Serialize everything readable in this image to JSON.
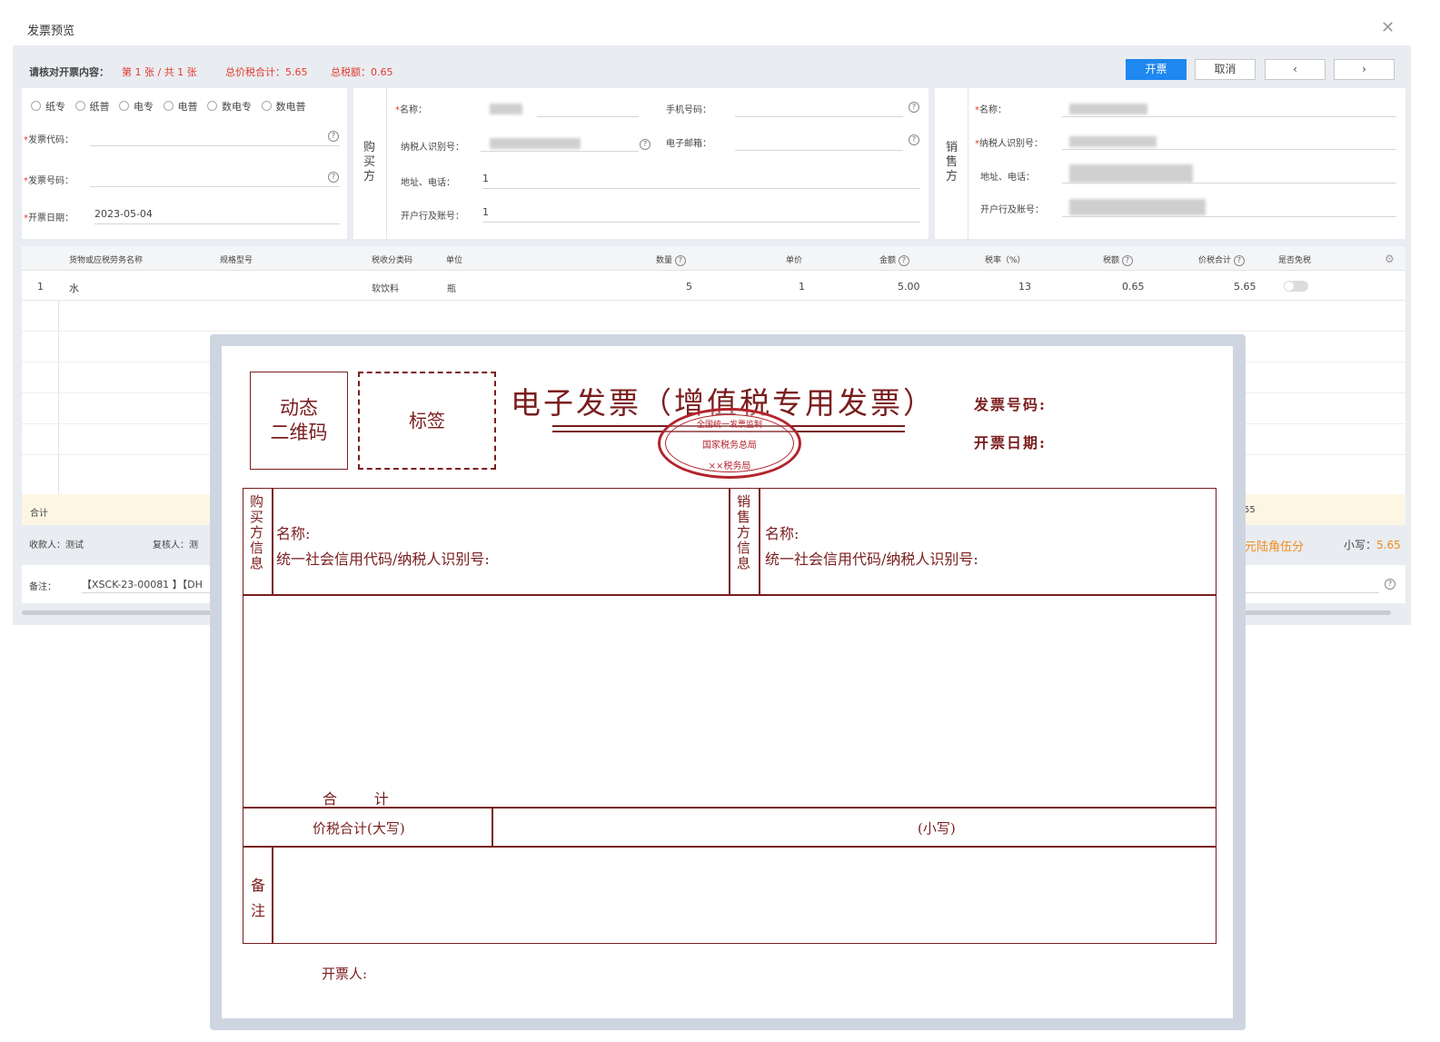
{
  "dialog": {
    "title": "发票预览"
  },
  "summary": {
    "prompt": "请核对开票内容：",
    "page": "第 1 张 / 共 1 张",
    "total_with_tax": "总价税合计：5.65",
    "total_tax": "总税额：0.65"
  },
  "toolbar": {
    "issue": "开票",
    "cancel": "取消",
    "prev": "‹",
    "next": "›"
  },
  "invoice_types": [
    "纸专",
    "纸普",
    "电专",
    "电普",
    "数电专",
    "数电普"
  ],
  "left": {
    "code_label": "发票代码：",
    "number_label": "发票号码：",
    "date_label": "开票日期：",
    "date_value": "2023-05-04"
  },
  "buyer": {
    "side": "购买方",
    "name": "名称：",
    "tax_id": "纳税人识别号：",
    "addr": "地址、电话：",
    "addr_val": "1",
    "bank": "开户行及账号：",
    "bank_val": "1",
    "phone": "手机号码：",
    "email": "电子邮箱："
  },
  "seller": {
    "side": "销售方",
    "name": "名称：",
    "tax_id": "纳税人识别号：",
    "addr": "地址、电话：",
    "bank": "开户行及账号："
  },
  "table": {
    "headers": [
      "货物或应税劳务名称",
      "规格型号",
      "税收分类码",
      "单位",
      "数量",
      "单价",
      "金额",
      "税率（%）",
      "税额",
      "价税合计",
      "是否免税"
    ],
    "rows": [
      {
        "no": "1",
        "name": "水",
        "spec": "",
        "code": "软饮料",
        "unit": "瓶",
        "qty": "5",
        "price": "1",
        "amount": "5.00",
        "rate": "13",
        "tax": "0.65",
        "total": "5.65"
      }
    ]
  },
  "footer": {
    "total": "合计",
    "total_tail": "55",
    "payee": "收款人：测试",
    "reviewer": "复核人：测",
    "words": "元陆角伍分",
    "small_label": "小写：",
    "small_val": "5.65",
    "remark_label": "备注：",
    "remark_val": "【XSCK-23-00081 】【DH"
  },
  "preview": {
    "qr": [
      "动态",
      "二维码"
    ],
    "tag": "标签",
    "title": "电子发票（增值税专用发票）",
    "number": "发票号码:",
    "date": "开票日期:",
    "seal_top": "全国统一发票监制",
    "seal_mid": "国家税务总局",
    "seal_bot": "××税务局",
    "buyer_side": "购买方信息",
    "seller_side": "销售方信息",
    "name": "名称:",
    "credit": "统一社会信用代码/纳税人识别号:",
    "sum": "合        计",
    "cap": "价税合计(大写)",
    "small": "(小写)",
    "remark": "备注",
    "drawer": "开票人:"
  }
}
